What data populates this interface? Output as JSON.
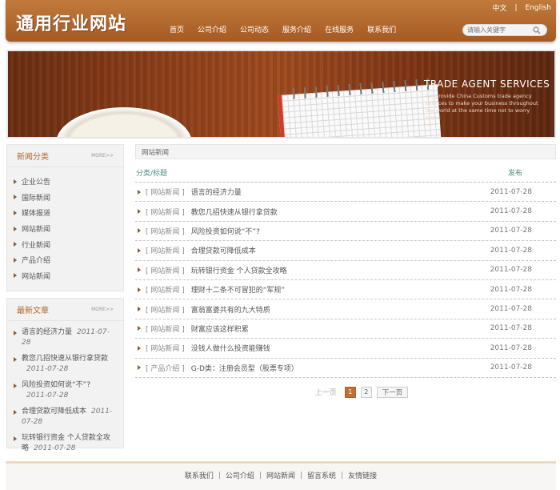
{
  "header": {
    "logo": "通用行业网站",
    "nav": [
      "首页",
      "公司介绍",
      "公司动态",
      "服务介绍",
      "在线服务",
      "联系我们"
    ],
    "lang_cn": "中文",
    "lang_sep": "|",
    "lang_en": "English",
    "search_placeholder": "请输入关键字"
  },
  "banner": {
    "title": "TRADE AGENT SERVICES",
    "subtitle": "We provide China Customs trade agency services to make your business throughout the world at the same time not to worry about"
  },
  "sidebar": {
    "categories": {
      "title": "新闻分类",
      "more": "MORE>>",
      "items": [
        "企业公告",
        "国际新闻",
        "媒体报道",
        "网站新闻",
        "行业新闻",
        "产品介绍",
        "网站新闻"
      ]
    },
    "latest": {
      "title": "最新文章",
      "more": "MORE>>",
      "items": [
        {
          "title": "语言的经济力量",
          "date": "2011-07-28"
        },
        {
          "title": "教您几招快速从银行拿贷款",
          "date": "2011-07-28"
        },
        {
          "title": "风险投资如何说“不”?",
          "date": "2011-07-28"
        },
        {
          "title": "合理贷款可降低成本",
          "date": "2011-07-28"
        },
        {
          "title": "玩转银行资金 个人贷款全攻略",
          "date": "2011-07-28"
        }
      ]
    }
  },
  "main": {
    "breadcrumb": "网站新闻",
    "col_title": "分类/标题",
    "col_date": "发布",
    "rows": [
      {
        "cat": "[ 网站新闻 ]",
        "title": "语言的经济力量",
        "date": "2011-07-28"
      },
      {
        "cat": "[ 网站新闻 ]",
        "title": "教您几招快速从银行拿贷款",
        "date": "2011-07-28"
      },
      {
        "cat": "[ 网站新闻 ]",
        "title": "风险投资如何说“不”?",
        "date": "2011-07-28"
      },
      {
        "cat": "[ 网站新闻 ]",
        "title": "合理贷款可降低成本",
        "date": "2011-07-28"
      },
      {
        "cat": "[ 网站新闻 ]",
        "title": "玩转银行资金 个人贷款全攻略",
        "date": "2011-07-28"
      },
      {
        "cat": "[ 网站新闻 ]",
        "title": "理财十二条不可冒犯的“军规”",
        "date": "2011-07-28"
      },
      {
        "cat": "[ 网站新闻 ]",
        "title": "富翁富婆共有的九大特质",
        "date": "2011-07-28"
      },
      {
        "cat": "[ 网站新闻 ]",
        "title": "财富应该这样积累",
        "date": "2011-07-28"
      },
      {
        "cat": "[ 网站新闻 ]",
        "title": "没钱人做什么投资能赚钱",
        "date": "2011-07-28"
      },
      {
        "cat": "[ 产品介绍 ]",
        "title": "G-D类：注册会员型（股票专项）",
        "date": "2011-07-28"
      }
    ],
    "pager": {
      "prev": "上一页",
      "pages": [
        "1",
        "2"
      ],
      "next": "下一页"
    }
  },
  "footer": {
    "links": [
      "联系我们",
      "公司介绍",
      "网站新闻",
      "留言系统",
      "友情链接"
    ],
    "sep": "|"
  },
  "colors": {
    "brand": "#b0682f",
    "header_bg": "#a75a24",
    "link_green": "#4f8d84"
  }
}
